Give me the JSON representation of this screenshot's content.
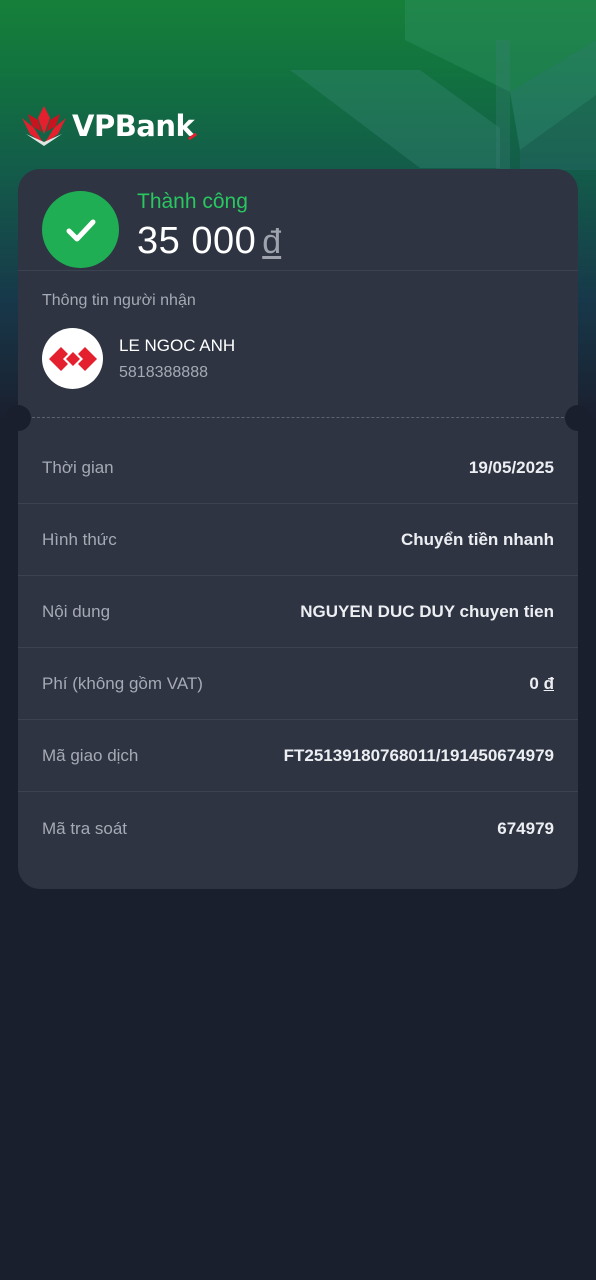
{
  "brand": {
    "logo_text": "VPBan",
    "logo_text_tail": "k"
  },
  "status": {
    "label": "Thành công",
    "amount": "35 000",
    "currency": "đ",
    "icon": "check-icon"
  },
  "recipient": {
    "heading": "Thông tin người nhận",
    "name": "LE NGOC ANH",
    "account": "5818388888",
    "bank_icon": "techcombank-logo-icon"
  },
  "details": [
    {
      "label": "Thời gian",
      "value": "19/05/2025"
    },
    {
      "label": "Hình thức",
      "value": "Chuyển tiền nhanh"
    },
    {
      "label": "Nội dung",
      "value": "NGUYEN DUC DUY chuyen tien"
    },
    {
      "label": "Phí (không gồm VAT)",
      "value": "0",
      "currency": "đ"
    },
    {
      "label": "Mã giao dịch",
      "value": "FT25139180768011/191450674979"
    },
    {
      "label": "Mã tra soát",
      "value": "674979"
    }
  ],
  "colors": {
    "success_green": "#28c760",
    "check_circle": "#1fae54",
    "card_bg": "#2e3442",
    "page_bg": "#1a1f2e",
    "brand_red": "#e5202e"
  }
}
